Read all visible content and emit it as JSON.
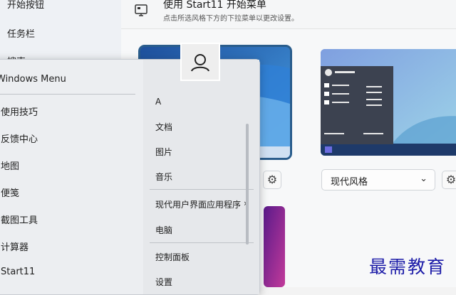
{
  "sidebar": {
    "items": [
      {
        "label": "开始按钮"
      },
      {
        "label": "任务栏"
      },
      {
        "label": "搜索"
      }
    ]
  },
  "header": {
    "title": "使用 Start11 开始菜单",
    "subtitle": "点击所选风格下方的下拉菜单以更改设置。",
    "icon": "monitor-icon"
  },
  "styles": {
    "selected_dropdown": "现代风格",
    "dropdown_icon": "chevron-down-icon",
    "gear_icon": "gear-icon"
  },
  "start_menu": {
    "title": "Windows Menu",
    "left_items": [
      {
        "label": "使用技巧"
      },
      {
        "label": "反馈中心"
      },
      {
        "label": "地图"
      },
      {
        "label": "便笺"
      },
      {
        "label": "截图工具"
      },
      {
        "label": "计算器"
      },
      {
        "label": "Start11"
      }
    ],
    "right_items": [
      {
        "label": "A"
      },
      {
        "label": "文档"
      },
      {
        "label": "图片"
      },
      {
        "label": "音乐"
      },
      {
        "label": "现代用户界面应用程序",
        "submenu_icon": "chevron-right-icon"
      },
      {
        "label": "电脑"
      },
      {
        "label": "控制面板"
      },
      {
        "label": "设置"
      }
    ],
    "avatar_icon": "user-icon"
  },
  "watermark": "最需教育",
  "colors": {
    "selected_border": "#2a5d8c",
    "watermark": "#1c1ca8"
  }
}
